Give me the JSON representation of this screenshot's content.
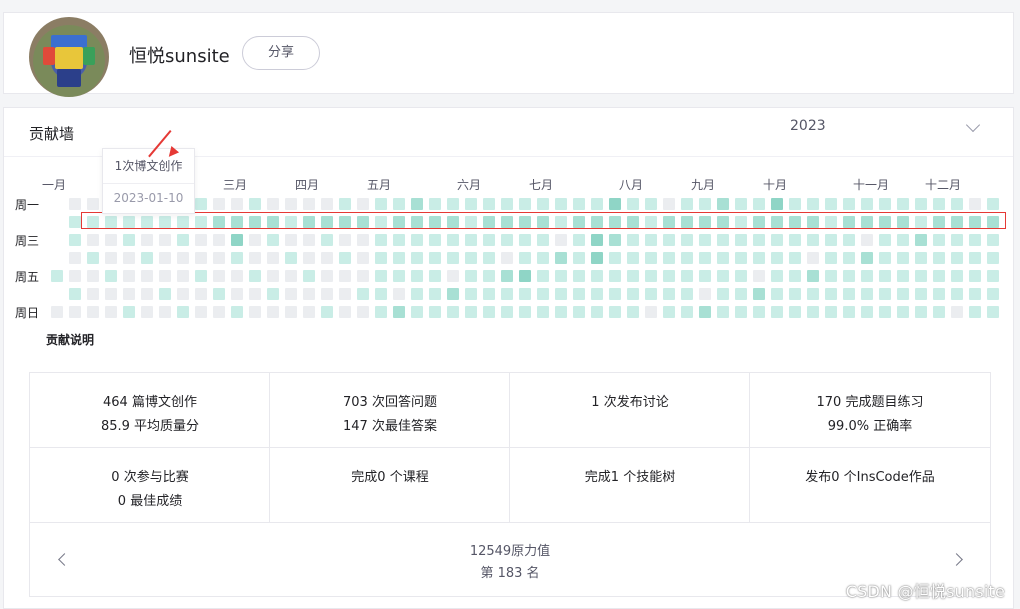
{
  "profile": {
    "username": "恒悦sunsite",
    "share_label": "分享"
  },
  "contribution": {
    "title": "贡献墙",
    "year": "2023",
    "months": [
      "一月",
      "三月",
      "四月",
      "五月",
      "六月",
      "七月",
      "八月",
      "九月",
      "十月",
      "十一月",
      "十二月"
    ],
    "weekdays": [
      "周一",
      "周三",
      "周五",
      "周日"
    ],
    "tooltip": {
      "count_prefix": "1",
      "count_label": "次博文创作",
      "date": "2023-01-10"
    },
    "explain_label": "贡献说明",
    "colors": {
      "empty": "#ebedf0",
      "level1": "#c9ede6",
      "level2": "#a8e0d4",
      "level3": "#8fd5c6",
      "highlight": "#e53935"
    }
  },
  "stats": [
    {
      "line1": "464 篇博文创作",
      "line2": "85.9 平均质量分"
    },
    {
      "line1": "703 次回答问题",
      "line2": "147 次最佳答案"
    },
    {
      "line1": "1 次发布讨论",
      "line2": ""
    },
    {
      "line1": "170 完成题目练习",
      "line2": "99.0% 正确率"
    },
    {
      "line1": "0 次参与比赛",
      "line2": "0 最佳成绩"
    },
    {
      "line1": "完成0 个课程",
      "line2": ""
    },
    {
      "line1": "完成1 个技能树",
      "line2": ""
    },
    {
      "line1": "发布0 个InsCode作品",
      "line2": ""
    }
  ],
  "power": {
    "value_label": "12549原力值",
    "rank_label": "第 183 名"
  },
  "watermark": "CSDN @恒悦sunsite"
}
